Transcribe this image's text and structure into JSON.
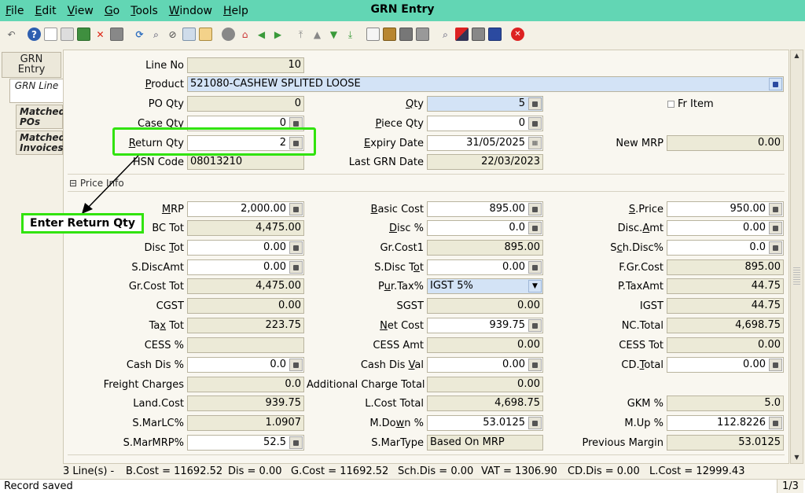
{
  "window": {
    "title": "GRN Entry"
  },
  "menu": [
    "File",
    "Edit",
    "View",
    "Go",
    "Tools",
    "Window",
    "Help"
  ],
  "toolbar": {
    "icons": [
      "undo-icon",
      "help-icon",
      "new-icon",
      "copy-icon",
      "save-icon",
      "delete-icon",
      "print-icon",
      "refresh-icon",
      "find-icon",
      "attach-icon",
      "link-icon",
      "report-icon",
      "record-icon",
      "home-icon",
      "back-icon",
      "forward-icon",
      "first-icon",
      "up-icon",
      "down-icon",
      "last-icon",
      "document-icon",
      "archive-icon",
      "printer-icon",
      "printer2-icon",
      "zoom-icon",
      "split-icon",
      "stack-icon",
      "book-icon",
      "close-icon"
    ]
  },
  "tabs": {
    "grn_entry": "GRN Entry",
    "grn_line": "GRN Line",
    "matched_pos": "Matched POs",
    "matched_invoices": "Matched Invoices"
  },
  "form": {
    "line_no": {
      "label": "Line No",
      "value": "10"
    },
    "product": {
      "label": "Product",
      "value": "521080-CASHEW SPLITED LOOSE"
    },
    "po_qty": {
      "label": "PO Qty",
      "value": "0"
    },
    "qty": {
      "label": "Qty",
      "value": "5"
    },
    "fr_item": {
      "label": "Fr Item"
    },
    "case_qty": {
      "label": "Case Qty",
      "value": "0"
    },
    "piece_qty": {
      "label": "Piece Qty",
      "value": "0"
    },
    "return_qty": {
      "label": "Return Qty",
      "value": "2"
    },
    "expiry_date": {
      "label": "Expiry Date",
      "value": "31/05/2025"
    },
    "new_mrp": {
      "label": "New MRP",
      "value": "0.00"
    },
    "hsn_code": {
      "label": "HSN Code",
      "value": "08013210"
    },
    "last_grn_date": {
      "label": "Last GRN Date",
      "value": "22/03/2023"
    }
  },
  "price_info": {
    "title": "Price Info",
    "mrp": {
      "label": "MRP",
      "value": "2,000.00"
    },
    "basic_cost": {
      "label": "Basic Cost",
      "value": "895.00"
    },
    "s_price": {
      "label": "S.Price",
      "value": "950.00"
    },
    "bc_tot": {
      "label": "BC Tot",
      "value": "4,475.00"
    },
    "disc_pct": {
      "label": "Disc %",
      "value": "0.0"
    },
    "disc_amt": {
      "label": "Disc.Amt",
      "value": "0.00"
    },
    "disc_tot": {
      "label": "Disc Tot",
      "value": "0.00"
    },
    "gr_cost1": {
      "label": "Gr.Cost1",
      "value": "895.00"
    },
    "sch_disc": {
      "label": "Sch.Disc%",
      "value": "0.0"
    },
    "s_disc_amt": {
      "label": "S.DiscAmt",
      "value": "0.00"
    },
    "s_disc_tot": {
      "label": "S.Disc Tot",
      "value": "0.00"
    },
    "f_gr_cost": {
      "label": "F.Gr.Cost",
      "value": "895.00"
    },
    "gr_cost_tot": {
      "label": "Gr.Cost Tot",
      "value": "4,475.00"
    },
    "pur_tax": {
      "label": "Pur.Tax%",
      "value": "IGST 5%"
    },
    "p_tax_amt": {
      "label": "P.TaxAmt",
      "value": "44.75"
    },
    "cgst": {
      "label": "CGST",
      "value": "0.00"
    },
    "sgst": {
      "label": "SGST",
      "value": "0.00"
    },
    "igst": {
      "label": "IGST",
      "value": "44.75"
    },
    "tax_tot": {
      "label": "Tax Tot",
      "value": "223.75"
    },
    "net_cost": {
      "label": "Net Cost",
      "value": "939.75"
    },
    "nc_total": {
      "label": "NC.Total",
      "value": "4,698.75"
    },
    "cess_pct": {
      "label": "CESS %",
      "value": ""
    },
    "cess_amt": {
      "label": "CESS Amt",
      "value": "0.00"
    },
    "cess_tot": {
      "label": "CESS Tot",
      "value": "0.00"
    },
    "cash_dis_pct": {
      "label": "Cash Dis %",
      "value": "0.0"
    },
    "cash_dis_val": {
      "label": "Cash Dis Val",
      "value": "0.00"
    },
    "cd_total": {
      "label": "CD.Total",
      "value": "0.00"
    },
    "freight": {
      "label": "Freight Charges",
      "value": "0.0"
    },
    "add_charge_total": {
      "label": "Additional Charge Total",
      "value": "0.00"
    },
    "land_cost": {
      "label": "Land.Cost",
      "value": "939.75"
    },
    "l_cost_total": {
      "label": "L.Cost Total",
      "value": "4,698.75"
    },
    "gkm_pct": {
      "label": "GKM %",
      "value": "5.0"
    },
    "s_marlc": {
      "label": "S.MarLC%",
      "value": "1.0907"
    },
    "m_down": {
      "label": "M.Down %",
      "value": "53.0125"
    },
    "m_up": {
      "label": "M.Up %",
      "value": "112.8226"
    },
    "s_marmrp": {
      "label": "S.MarMRP%",
      "value": "52.5"
    },
    "s_martype": {
      "label": "S.MarType",
      "value": "Based On MRP"
    },
    "prev_margin": {
      "label": "Previous Margin",
      "value": "53.0125"
    }
  },
  "annotation": {
    "text": "Enter Return Qty",
    "color": "#31e30c"
  },
  "totals": {
    "lines": "3 Line(s) -",
    "b_cost": "B.Cost = 11692.52",
    "dis": "Dis = 0.00",
    "g_cost": "G.Cost = 11692.52",
    "sch_dis": "Sch.Dis = 0.00",
    "vat": "VAT = 1306.90",
    "cd_dis": "CD.Dis = 0.00",
    "l_cost": "L.Cost = 12999.43"
  },
  "status": {
    "message": "Record saved",
    "page": "1/3"
  }
}
